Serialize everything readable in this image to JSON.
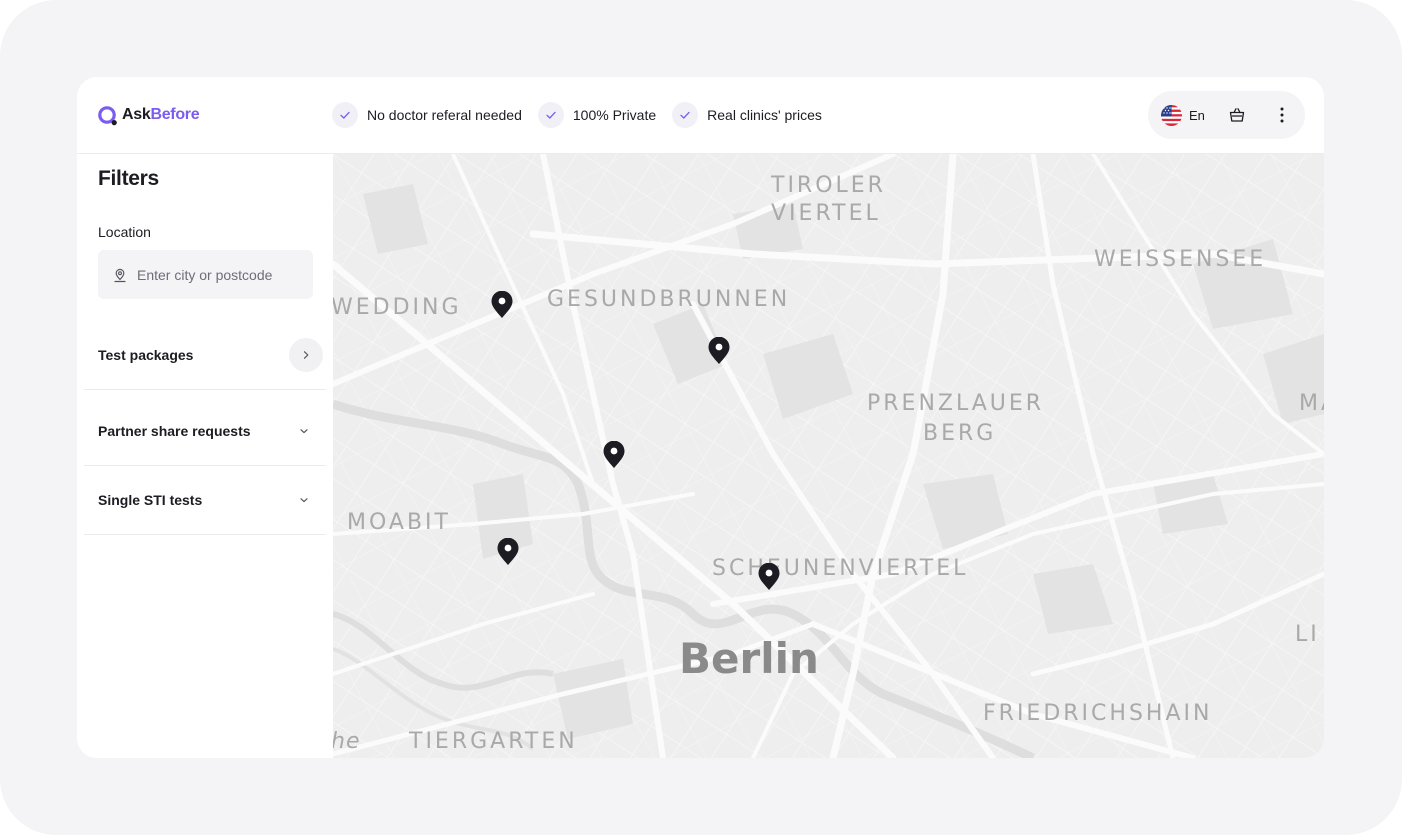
{
  "brand": {
    "name_part1": "Ask",
    "name_part2": "Before",
    "accent": "#7a5cf0"
  },
  "header": {
    "features": [
      {
        "icon": "check-icon",
        "label": "No doctor referal needed"
      },
      {
        "icon": "check-icon",
        "label": "100% Private"
      },
      {
        "icon": "check-icon",
        "label": "Real clinics' prices"
      }
    ],
    "language": {
      "flag": "us-flag-icon",
      "label": "En"
    },
    "cart_icon": "basket-icon",
    "menu_icon": "more-vertical-icon"
  },
  "sidebar": {
    "title": "Filters",
    "location": {
      "label": "Location",
      "placeholder": "Enter city or postcode",
      "value": ""
    },
    "sections": [
      {
        "label": "Test packages",
        "icon": "chevron-right-icon"
      },
      {
        "label": "Partner share requests",
        "icon": "chevron-down-icon"
      },
      {
        "label": "Single STI tests",
        "icon": "chevron-down-icon"
      }
    ]
  },
  "map": {
    "labels": {
      "tiroler": "TIROLER",
      "viertel": "VIERTEL",
      "weissensee": "WEISSENSEE",
      "wedding": "WEDDING",
      "gesundbrunnen": "GESUNDBRUNNEN",
      "prenzlauer": "PRENZLAUER",
      "berg": "BERG",
      "ma": "MA",
      "moabit": "MOABIT",
      "scheunenviertel": "SCHEUNENVIERTEL",
      "berlin": "Berlin",
      "li": "LI",
      "friedrichshain": "FRIEDRICHSHAIN",
      "he": "he",
      "tiergarten": "TIERGARTEN"
    },
    "marker_count": 5
  }
}
